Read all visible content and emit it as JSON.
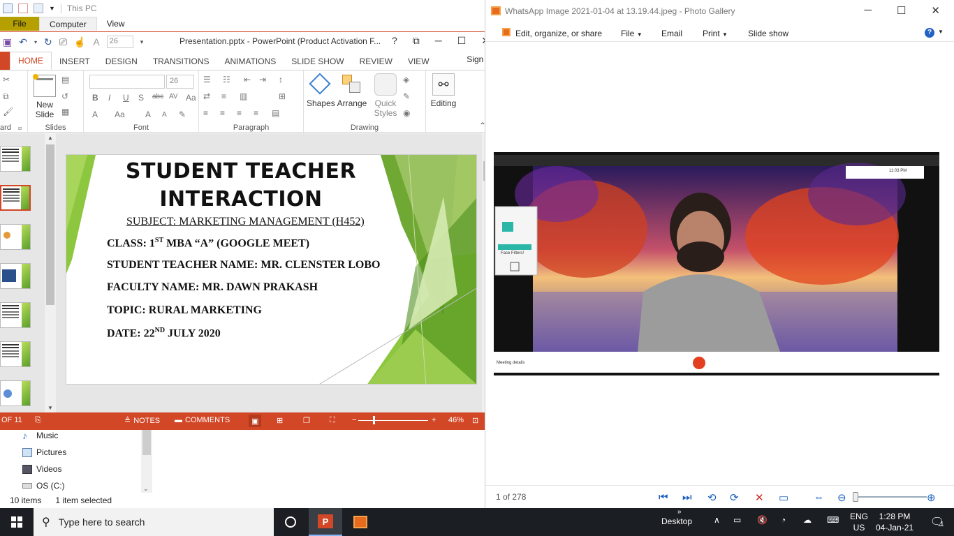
{
  "explorer": {
    "title": "This PC",
    "tabs": [
      "File",
      "Computer",
      "View"
    ],
    "nav_items": [
      {
        "label": "Music",
        "icon": "music-icon"
      },
      {
        "label": "Pictures",
        "icon": "pictures-icon"
      },
      {
        "label": "Videos",
        "icon": "videos-icon"
      },
      {
        "label": "OS (C:)",
        "icon": "drive-icon"
      }
    ],
    "status_items": "10 items",
    "status_selected": "1 item selected"
  },
  "powerpoint": {
    "title": "Presentation.pptx - PowerPoint (Product Activation F...",
    "font_size_mini": "26",
    "tabs": [
      "HOME",
      "INSERT",
      "DESIGN",
      "TRANSITIONS",
      "ANIMATIONS",
      "SLIDE SHOW",
      "REVIEW",
      "VIEW"
    ],
    "active_tab": "HOME",
    "sign_in": "Sign in",
    "ribbon": {
      "clipboard_label": "ard",
      "new_slide": "New",
      "new_slide_2": "Slide",
      "slides_label": "Slides",
      "font_size": "26",
      "font_label": "Font",
      "paragraph_label": "Paragraph",
      "shapes": "Shapes",
      "arrange": "Arrange",
      "quick_styles": "Quick",
      "quick_styles_2": "Styles",
      "drawing_label": "Drawing",
      "editing": "Editing"
    },
    "slide": {
      "title_line1": "STUDENT TEACHER",
      "title_line2": "INTERACTION",
      "subject": "SUBJECT: MARKETING MANAGEMENT (H452)",
      "class_pre": "CLASS: 1",
      "class_sup": "ST",
      "class_post": " MBA “A” (GOOGLE MEET)",
      "student": "STUDENT TEACHER NAME: MR. CLENSTER LOBO",
      "faculty": "FACULTY NAME: MR. DAWN PRAKASH",
      "topic": "TOPIC: RURAL MARKETING",
      "date_pre": "DATE: 22",
      "date_sup": "ND",
      "date_post": " JULY 2020"
    },
    "status": {
      "slide_of": "OF 11",
      "notes": "NOTES",
      "comments": "COMMENTS",
      "zoom": "46%",
      "zoom_level": 0.22
    },
    "accent_color": "#D24726"
  },
  "photo_gallery": {
    "title": "WhatsApp Image 2021-01-04 at 13.19.44.jpeg - Photo Gallery",
    "menu": [
      "Edit, organize, or share",
      "File",
      "Email",
      "Print",
      "Slide show"
    ],
    "count": "1 of 278",
    "meet": {
      "time": "11:03 PM",
      "meeting_details": "Meeting details",
      "face_filters": "Face Filters!"
    }
  },
  "taskbar": {
    "search_placeholder": "Type here to search",
    "desktop": "Desktop",
    "lang1": "ENG",
    "lang2": "US",
    "time": "1:28 PM",
    "date": "04-Jan-21",
    "notifications": "1"
  }
}
